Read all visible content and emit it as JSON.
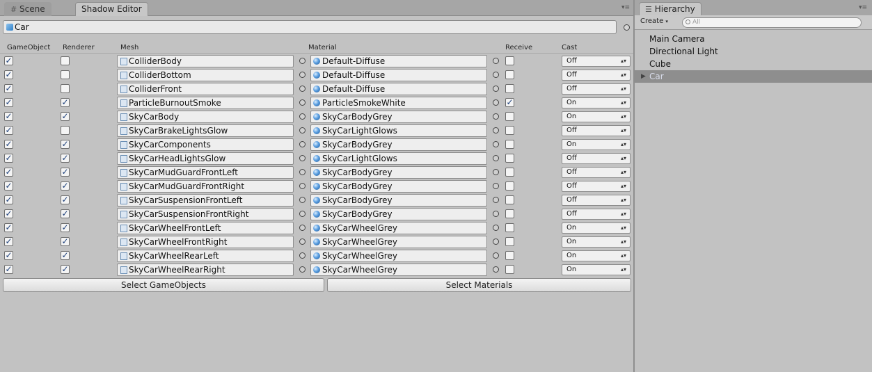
{
  "tabs": {
    "scene": "Scene",
    "shadow_editor": "Shadow Editor",
    "hierarchy": "Hierarchy"
  },
  "search": {
    "value": "Car"
  },
  "columns": {
    "gameobject": "GameObject",
    "renderer": "Renderer",
    "mesh": "Mesh",
    "material": "Material",
    "receive": "Receive",
    "cast": "Cast"
  },
  "rows": [
    {
      "go": true,
      "renderer": false,
      "mesh": "ColliderBody",
      "material": "Default-Diffuse",
      "receive": false,
      "cast": "Off",
      "mesh_icon": "mesh-icon"
    },
    {
      "go": true,
      "renderer": false,
      "mesh": "ColliderBottom",
      "material": "Default-Diffuse",
      "receive": false,
      "cast": "Off",
      "mesh_icon": "mesh-icon"
    },
    {
      "go": true,
      "renderer": false,
      "mesh": "ColliderFront",
      "material": "Default-Diffuse",
      "receive": false,
      "cast": "Off",
      "mesh_icon": "mesh-icon"
    },
    {
      "go": true,
      "renderer": true,
      "mesh": "ParticleBurnoutSmoke",
      "material": "ParticleSmokeWhite",
      "receive": true,
      "cast": "On",
      "mesh_icon": "blank-mesh-icon"
    },
    {
      "go": true,
      "renderer": true,
      "mesh": "SkyCarBody",
      "material": "SkyCarBodyGrey",
      "receive": false,
      "cast": "On",
      "mesh_icon": "mesh-icon"
    },
    {
      "go": true,
      "renderer": false,
      "mesh": "SkyCarBrakeLightsGlow",
      "material": "SkyCarLightGlows",
      "receive": false,
      "cast": "Off",
      "mesh_icon": "mesh-icon"
    },
    {
      "go": true,
      "renderer": true,
      "mesh": "SkyCarComponents",
      "material": "SkyCarBodyGrey",
      "receive": false,
      "cast": "On",
      "mesh_icon": "mesh-icon"
    },
    {
      "go": true,
      "renderer": true,
      "mesh": "SkyCarHeadLightsGlow",
      "material": "SkyCarLightGlows",
      "receive": false,
      "cast": "Off",
      "mesh_icon": "mesh-icon"
    },
    {
      "go": true,
      "renderer": true,
      "mesh": "SkyCarMudGuardFrontLeft",
      "material": "SkyCarBodyGrey",
      "receive": false,
      "cast": "Off",
      "mesh_icon": "mesh-icon"
    },
    {
      "go": true,
      "renderer": true,
      "mesh": "SkyCarMudGuardFrontRight",
      "material": "SkyCarBodyGrey",
      "receive": false,
      "cast": "Off",
      "mesh_icon": "mesh-icon"
    },
    {
      "go": true,
      "renderer": true,
      "mesh": "SkyCarSuspensionFrontLeft",
      "material": "SkyCarBodyGrey",
      "receive": false,
      "cast": "Off",
      "mesh_icon": "mesh-icon"
    },
    {
      "go": true,
      "renderer": true,
      "mesh": "SkyCarSuspensionFrontRight",
      "material": "SkyCarBodyGrey",
      "receive": false,
      "cast": "Off",
      "mesh_icon": "mesh-icon"
    },
    {
      "go": true,
      "renderer": true,
      "mesh": "SkyCarWheelFrontLeft",
      "material": "SkyCarWheelGrey",
      "receive": false,
      "cast": "On",
      "mesh_icon": "mesh-icon"
    },
    {
      "go": true,
      "renderer": true,
      "mesh": "SkyCarWheelFrontRight",
      "material": "SkyCarWheelGrey",
      "receive": false,
      "cast": "On",
      "mesh_icon": "mesh-icon"
    },
    {
      "go": true,
      "renderer": true,
      "mesh": "SkyCarWheelRearLeft",
      "material": "SkyCarWheelGrey",
      "receive": false,
      "cast": "On",
      "mesh_icon": "mesh-icon"
    },
    {
      "go": true,
      "renderer": true,
      "mesh": "SkyCarWheelRearRight",
      "material": "SkyCarWheelGrey",
      "receive": false,
      "cast": "On",
      "mesh_icon": "mesh-icon"
    }
  ],
  "buttons": {
    "select_gameobjects": "Select GameObjects",
    "select_materials": "Select Materials"
  },
  "hierarchy": {
    "create_label": "Create",
    "search_placeholder": "All",
    "items": [
      {
        "label": "Main Camera",
        "selected": false
      },
      {
        "label": "Directional Light",
        "selected": false
      },
      {
        "label": "Cube",
        "selected": false
      },
      {
        "label": "Car",
        "selected": true
      }
    ]
  },
  "colors": {
    "panel_bg": "#c2c2c2",
    "selection_bg": "#8e8e8e",
    "check_color": "#1c3f7a"
  }
}
